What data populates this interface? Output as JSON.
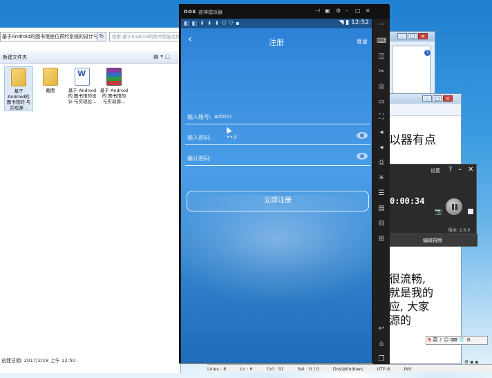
{
  "explorer": {
    "address": "基于Android的图书馆座位预约系统的设计与实现",
    "search_placeholder": "搜索 基于Android的图书馆座位预约系统的设计与实现",
    "toolbar_new_folder": "新建文件夹",
    "files": [
      {
        "label": "基于Android的图书馆座位预约系统的设计与实现源码",
        "kind": "folder",
        "short": "基于 Android的 图书馆的 与实现源..."
      },
      {
        "label": "截图",
        "kind": "folder",
        "short": "截图"
      },
      {
        "label": "基于Android的图书馆座位预约系统的设计与实现论文",
        "kind": "doc",
        "short": "基于 Android的 图书馆的设计 与实现论..."
      },
      {
        "label": "基于Android的图书馆座位预约系统的设计与实现源码",
        "kind": "rar",
        "short": "基于 Android的 图书馆的 与实现源..."
      }
    ],
    "status": "创建日期: 2017/2/18 上午 12:50"
  },
  "nox": {
    "logo": "nox",
    "title": "夜神模拟器",
    "time": "12:52"
  },
  "app": {
    "title": "注册",
    "login": "登录",
    "account_label": "输入账号:",
    "account_value": "admin",
    "password_label": "输入密码:",
    "password_value": "••3",
    "confirm_label": "确认密码:",
    "confirm_value": "",
    "register_button": "立即注册"
  },
  "recorder": {
    "settings": "设置",
    "time": "0:00:34",
    "version": "版本: 2.6.0",
    "bottom": "编辑視频"
  },
  "editor": {
    "line1": "以器有点",
    "lines": [
      "很流畅,",
      "就是我的",
      "应, 大家",
      "源的"
    ],
    "status": [
      "Lines : 8",
      "Ln : 6",
      "Col : 31",
      "Sel : 0 | 0",
      "Dos\\Windows",
      "UTF-8",
      "INS"
    ]
  },
  "ime": {
    "text": "英 ♪ ☺ ⌨ 👕 ⚙"
  },
  "colors": {
    "android_blue": "#3a8fe0",
    "nox_dark": "#1a1a1a"
  }
}
